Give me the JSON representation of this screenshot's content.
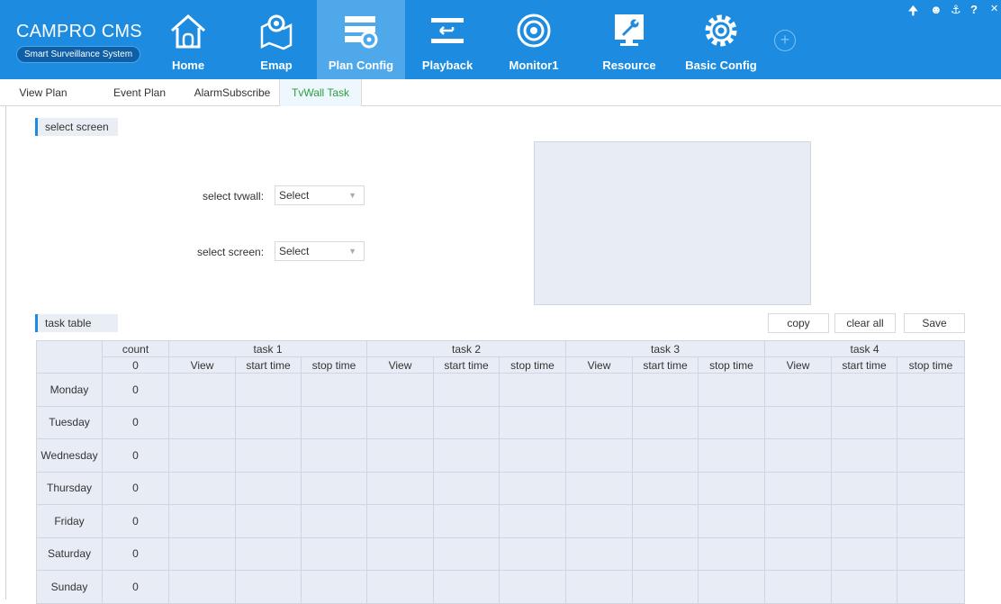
{
  "brand": {
    "title": "CAMPRO CMS",
    "subtitle": "Smart Surveillance System"
  },
  "nav": [
    {
      "label": "Home",
      "icon": "home-icon"
    },
    {
      "label": "Emap",
      "icon": "map-pin-icon"
    },
    {
      "label": "Plan Config",
      "icon": "plan-config-icon",
      "active": true
    },
    {
      "label": "Playback",
      "icon": "playback-icon"
    },
    {
      "label": "Monitor1",
      "icon": "monitor-target-icon"
    },
    {
      "label": "Resource",
      "icon": "wrench-screen-icon"
    },
    {
      "label": "Basic Config",
      "icon": "gear-icon"
    }
  ],
  "tabs": [
    {
      "label": "View Plan"
    },
    {
      "label": "Event Plan"
    },
    {
      "label": "AlarmSubscribe"
    },
    {
      "label": "TvWall Task",
      "active": true
    }
  ],
  "select_screen": {
    "section_title": "select screen",
    "tvwall_label": "select tvwall:",
    "tvwall_value": "Select",
    "screen_label": "select screen:",
    "screen_value": "Select"
  },
  "task_table": {
    "section_title": "task table",
    "buttons": {
      "copy": "copy",
      "clear_all": "clear all",
      "save": "Save"
    },
    "count_header": "count",
    "count_total": "0",
    "tasks": [
      "task 1",
      "task 2",
      "task 3",
      "task 4"
    ],
    "sub_columns": [
      "View",
      "start time",
      "stop time"
    ],
    "days": [
      {
        "name": "Monday",
        "count": "0"
      },
      {
        "name": "Tuesday",
        "count": "0"
      },
      {
        "name": "Wednesday",
        "count": "0"
      },
      {
        "name": "Thursday",
        "count": "0"
      },
      {
        "name": "Friday",
        "count": "0"
      },
      {
        "name": "Saturday",
        "count": "0"
      },
      {
        "name": "Sunday",
        "count": "0"
      }
    ]
  },
  "colors": {
    "header_bg": "#1d8ce0",
    "active_nav_bg": "#4fa8ea",
    "active_tab_text": "#2a9d3c",
    "table_bg": "#e8edf5"
  }
}
